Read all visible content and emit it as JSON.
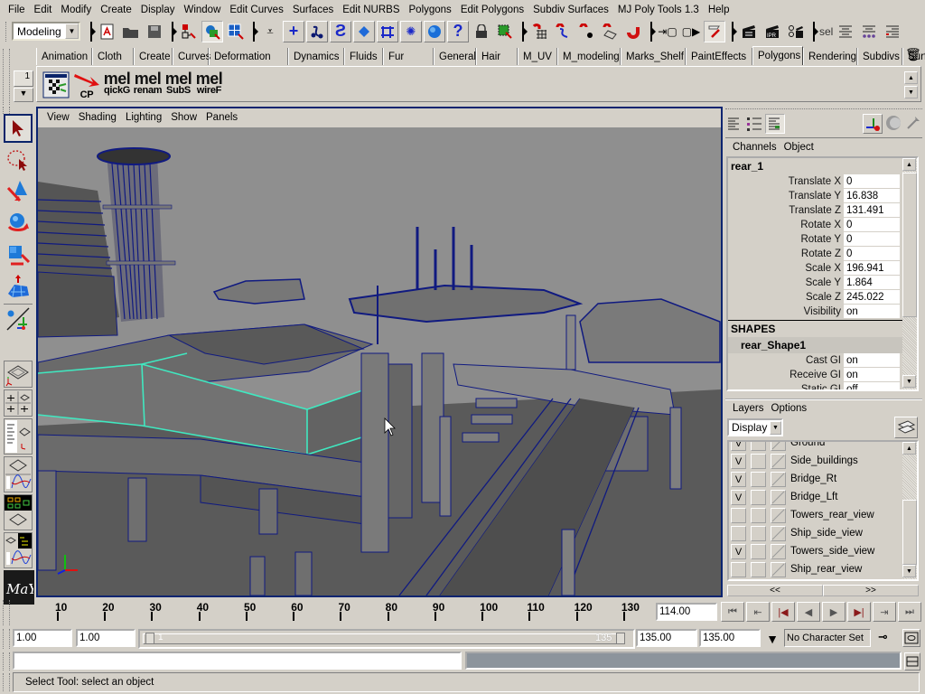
{
  "menubar": {
    "items": [
      "File",
      "Edit",
      "Modify",
      "Create",
      "Display",
      "Window",
      "Edit Curves",
      "Surfaces",
      "Edit NURBS",
      "Polygons",
      "Edit Polygons",
      "Subdiv Surfaces",
      "MJ Poly Tools 1.3",
      "Help"
    ]
  },
  "statusline": {
    "mode": "Modeling",
    "sel_label": "sel",
    "icons": [
      "new-scene-icon",
      "open-scene-icon",
      "save-scene-icon",
      "select-hierarchy-icon",
      "select-object-icon",
      "select-component-icon",
      "lock-selection-icon",
      "snap-grid-icon",
      "snap-curve-icon",
      "snap-point-icon",
      "snap-view-plane-icon",
      "make-live-icon",
      "input-ops-icon",
      "output-ops-icon",
      "construction-history-icon",
      "render-icon",
      "ipr-render-icon",
      "render-globals-icon"
    ]
  },
  "shelf": {
    "tabs": [
      "Animation",
      "Cloth",
      "Create",
      "Curves",
      "Deformation",
      "Dynamics",
      "Fluids",
      "Fur",
      "General",
      "Hair",
      "M_UV",
      "M_modeling",
      "Marks_Shelf",
      "PaintEffects",
      "Polygons",
      "Rendering",
      "Subdivs",
      "Surfaces"
    ],
    "active_tab": "Polygons",
    "buttons": [
      {
        "icon": "checker-uv-icon",
        "label": ""
      },
      {
        "icon": "red-arrow-icon",
        "label": "CP"
      },
      {
        "icon_text": "mel",
        "label": "qickG"
      },
      {
        "icon_text": "mel",
        "label": "renam"
      },
      {
        "icon_text": "mel",
        "label": "SubS"
      },
      {
        "icon_text": "mel",
        "label": "wireF"
      }
    ],
    "side_field": "1"
  },
  "toolbox": {
    "tools": [
      "select-tool-icon",
      "lasso-tool-icon",
      "move-tool-icon",
      "rotate-tool-icon",
      "scale-tool-icon",
      "manipulator-tool-icon",
      "last-tool-icon"
    ],
    "active": "select-tool-icon"
  },
  "panel": {
    "menu": [
      "View",
      "Shading",
      "Lighting",
      "Show",
      "Panels"
    ]
  },
  "channelbox": {
    "menu": [
      "Channels",
      "Object"
    ],
    "object_name": "rear_1",
    "attributes": [
      {
        "label": "Translate X",
        "value": "0"
      },
      {
        "label": "Translate Y",
        "value": "16.838"
      },
      {
        "label": "Translate Z",
        "value": "131.491"
      },
      {
        "label": "Rotate X",
        "value": "0"
      },
      {
        "label": "Rotate Y",
        "value": "0"
      },
      {
        "label": "Rotate Z",
        "value": "0"
      },
      {
        "label": "Scale X",
        "value": "196.941"
      },
      {
        "label": "Scale Y",
        "value": "1.864"
      },
      {
        "label": "Scale Z",
        "value": "245.022"
      },
      {
        "label": "Visibility",
        "value": "on"
      }
    ],
    "shapes_header": "SHAPES",
    "shape_name": "rear_Shape1",
    "shape_attributes": [
      {
        "label": "Cast GI",
        "value": "on"
      },
      {
        "label": "Receive GI",
        "value": "on"
      },
      {
        "label": "Static GI",
        "value": "off"
      }
    ]
  },
  "layers": {
    "menu": [
      "Layers",
      "Options"
    ],
    "display_mode": "Display",
    "items": [
      {
        "visible": "V",
        "name": "Ground"
      },
      {
        "visible": "V",
        "name": "Side_buildings"
      },
      {
        "visible": "V",
        "name": "Bridge_Rt"
      },
      {
        "visible": "V",
        "name": "Bridge_Lft"
      },
      {
        "visible": "",
        "name": "Towers_rear_view"
      },
      {
        "visible": "",
        "name": "Ship_side_view"
      },
      {
        "visible": "V",
        "name": "Towers_side_view"
      },
      {
        "visible": "",
        "name": "Ship_rear_view"
      }
    ],
    "nav_prev": "<<",
    "nav_next": ">>"
  },
  "timeline": {
    "ticks": [
      10,
      20,
      30,
      40,
      50,
      60,
      70,
      80,
      90,
      100,
      110,
      120,
      130
    ],
    "range_start": 1,
    "range_end": 135,
    "current_frame": "114.00",
    "start_time": "1.00",
    "playback_start": "1.00",
    "range_slider_start_label": "1",
    "range_slider_end_label": "135",
    "playback_end": "135.00",
    "end_time": "135.00",
    "character_set": "No Character Set",
    "playback_buttons": [
      "go-to-start-icon",
      "step-back-key-icon",
      "step-back-frame-icon",
      "play-backwards-icon",
      "play-forwards-icon",
      "step-forward-frame-icon",
      "step-forward-key-icon",
      "go-to-end-icon"
    ]
  },
  "help_line": "Select Tool: select an object",
  "colors": {
    "ui_bg": "#d4d0c8",
    "viewport_bg": "#8c8c8c",
    "wire_blue": "#0b1580",
    "selection_cyan": "#40e8c0",
    "panel_border": "#0b2470"
  }
}
